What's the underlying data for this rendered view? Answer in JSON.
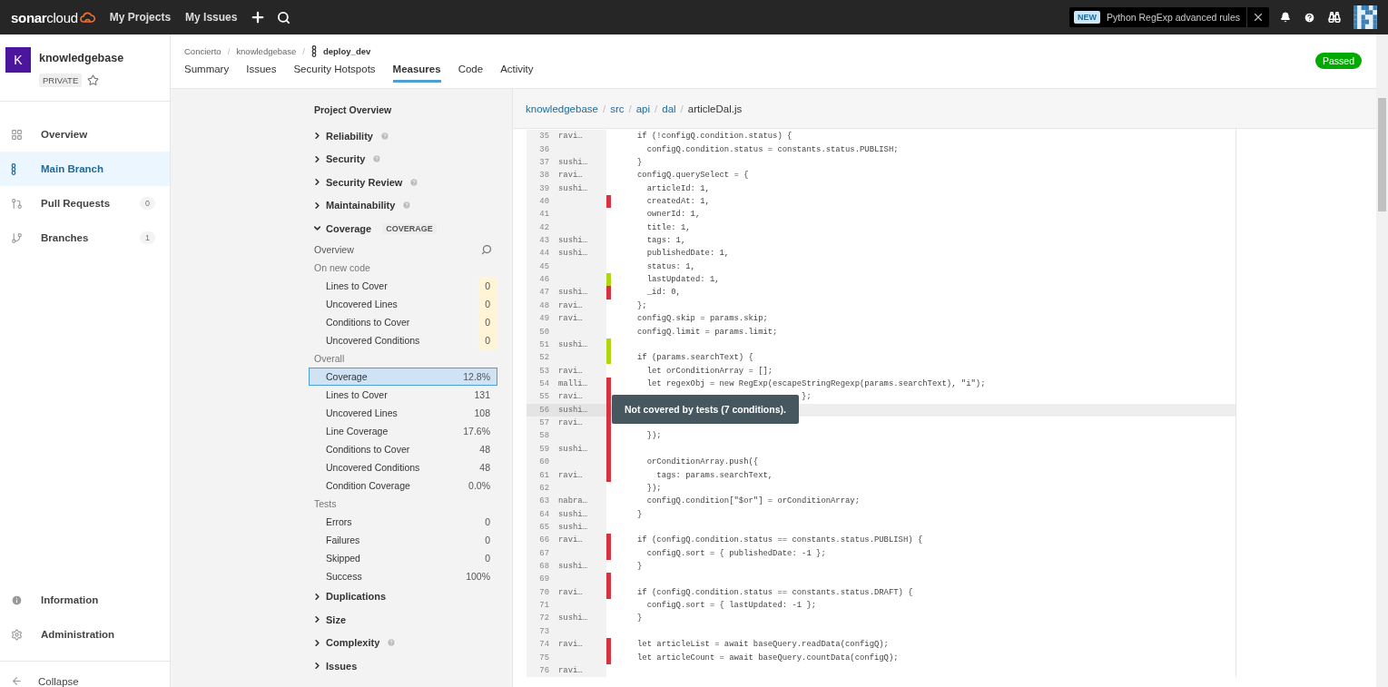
{
  "topbar": {
    "logo": "**sonar**cloud",
    "links": [
      "My Projects",
      "My Issues"
    ],
    "notice": {
      "badge": "NEW",
      "text": "Python RegExp advanced rules"
    }
  },
  "sidebar": {
    "project": {
      "letter": "K",
      "name": "knowledgebase",
      "visibility": "PRIVATE"
    },
    "items": [
      {
        "kind": "overview",
        "label": "Overview",
        "selected": false
      },
      {
        "kind": "branch",
        "label": "Main Branch",
        "selected": true
      },
      {
        "kind": "pull",
        "label": "Pull Requests",
        "count": "0",
        "selected": false
      },
      {
        "kind": "branches",
        "label": "Branches",
        "count": "1",
        "selected": false
      }
    ],
    "bottom_items": [
      {
        "kind": "info",
        "label": "Information"
      },
      {
        "kind": "settings",
        "label": "Administration"
      }
    ],
    "collapse": "Collapse"
  },
  "header": {
    "separator": "/",
    "breadcrumb": [
      "Concierto",
      "knowledgebase"
    ],
    "branch": "deploy_dev",
    "status": "Passed",
    "tabs": [
      {
        "label": "Summary",
        "selected": false
      },
      {
        "label": "Issues",
        "selected": false
      },
      {
        "label": "Security Hotspots",
        "selected": false
      },
      {
        "label": "Measures",
        "selected": true
      },
      {
        "label": "Code",
        "selected": false
      },
      {
        "label": "Activity",
        "selected": false
      }
    ]
  },
  "measures": {
    "title": "Project Overview",
    "domains": [
      {
        "name": "Reliability",
        "help": true,
        "expanded": false
      },
      {
        "name": "Security",
        "help": true,
        "expanded": false
      },
      {
        "name": "Security Review",
        "help": true,
        "expanded": false
      },
      {
        "name": "Maintainability",
        "help": true,
        "expanded": false
      },
      {
        "name": "Coverage",
        "tag": "COVERAGE",
        "help": false,
        "expanded": true,
        "overview": "Overview",
        "groups": [
          {
            "label": "On new code",
            "items": [
              {
                "label": "Lines to Cover",
                "value": "0",
                "new_code": true,
                "selected": false
              },
              {
                "label": "Uncovered Lines",
                "value": "0",
                "new_code": true,
                "selected": false
              },
              {
                "label": "Conditions to Cover",
                "value": "0",
                "new_code": true,
                "selected": false
              },
              {
                "label": "Uncovered Conditions",
                "value": "0",
                "new_code": true,
                "selected": false
              }
            ]
          },
          {
            "label": "Overall",
            "items": [
              {
                "label": "Coverage",
                "value": "12.8%",
                "new_code": false,
                "selected": true
              },
              {
                "label": "Lines to Cover",
                "value": "131",
                "new_code": false,
                "selected": false
              },
              {
                "label": "Uncovered Lines",
                "value": "108",
                "new_code": false,
                "selected": false
              },
              {
                "label": "Line Coverage",
                "value": "17.6%",
                "new_code": false,
                "selected": false
              },
              {
                "label": "Conditions to Cover",
                "value": "48",
                "new_code": false,
                "selected": false
              },
              {
                "label": "Uncovered Conditions",
                "value": "48",
                "new_code": false,
                "selected": false
              },
              {
                "label": "Condition Coverage",
                "value": "0.0%",
                "new_code": false,
                "selected": false
              }
            ]
          },
          {
            "label": "Tests",
            "items": [
              {
                "label": "Errors",
                "value": "0",
                "new_code": false,
                "selected": false
              },
              {
                "label": "Failures",
                "value": "0",
                "new_code": false,
                "selected": false
              },
              {
                "label": "Skipped",
                "value": "0",
                "new_code": false,
                "selected": false
              },
              {
                "label": "Success",
                "value": "100%",
                "new_code": false,
                "selected": false
              }
            ]
          }
        ]
      },
      {
        "name": "Duplications",
        "help": false,
        "expanded": false
      },
      {
        "name": "Size",
        "help": false,
        "expanded": false
      },
      {
        "name": "Complexity",
        "help": true,
        "expanded": false
      },
      {
        "name": "Issues",
        "help": false,
        "expanded": false
      }
    ]
  },
  "source": {
    "separator": "/",
    "path": [
      "knowledgebase",
      "src",
      "api",
      "dal"
    ],
    "file": "articleDal.js",
    "lines": [
      {
        "n": "35",
        "author": "ravi…",
        "code": "if (!configQ.condition.status) {",
        "highlighted": false
      },
      {
        "n": "36",
        "code": "  configQ.condition.status = constants.status.PUBLISH;",
        "highlighted": false
      },
      {
        "n": "37",
        "author": "sushi…",
        "code": "}",
        "highlighted": false
      },
      {
        "n": "38",
        "author": "ravi…",
        "code": "configQ.querySelect = {",
        "highlighted": false
      },
      {
        "n": "39",
        "author": "sushi…",
        "code": "  articleId: 1,",
        "highlighted": false
      },
      {
        "n": "40",
        "covered": false,
        "code": "  createdAt: 1,",
        "highlighted": false
      },
      {
        "n": "41",
        "code": "  ownerId: 1,",
        "highlighted": false
      },
      {
        "n": "42",
        "code": "  title: 1,",
        "highlighted": false
      },
      {
        "n": "43",
        "author": "sushi…",
        "code": "  tags: 1,",
        "highlighted": false
      },
      {
        "n": "44",
        "author": "sushi…",
        "code": "  publishedDate: 1,",
        "highlighted": false
      },
      {
        "n": "45",
        "code": "  status: 1,",
        "highlighted": false
      },
      {
        "n": "46",
        "covered": true,
        "code": "  lastUpdated: 1,",
        "highlighted": false
      },
      {
        "n": "47",
        "author": "sushi…",
        "covered": false,
        "code": "  _id: 0,",
        "highlighted": false
      },
      {
        "n": "48",
        "author": "ravi…",
        "code": "};",
        "highlighted": false
      },
      {
        "n": "49",
        "author": "ravi…",
        "code": "configQ.skip = params.skip;",
        "highlighted": false
      },
      {
        "n": "50",
        "code": "configQ.limit = params.limit;",
        "highlighted": false
      },
      {
        "n": "51",
        "author": "sushi…",
        "covered": true,
        "highlighted": false
      },
      {
        "n": "52",
        "covered": true,
        "code": "if (params.searchText) {",
        "highlighted": false
      },
      {
        "n": "53",
        "author": "ravi…",
        "code": "  let orConditionArray = [];",
        "highlighted": false
      },
      {
        "n": "54",
        "author": "malli…",
        "covered": false,
        "code": "  let regexObj = new RegExp(escapeStringRegexp(params.searchText), \"i\");",
        "highlighted": false
      },
      {
        "n": "55",
        "author": "ravi…",
        "covered": false,
        "code": "                                  };",
        "highlighted": false
      },
      {
        "n": "56",
        "author": "sushi…",
        "covered": false,
        "highlighted": true,
        "tooltip": "Not covered by tests (7 conditions)."
      },
      {
        "n": "57",
        "author": "ravi…",
        "covered": false,
        "highlighted": false
      },
      {
        "n": "58",
        "covered": false,
        "code": "  });",
        "highlighted": false
      },
      {
        "n": "59",
        "author": "sushi…",
        "covered": false,
        "highlighted": false
      },
      {
        "n": "60",
        "covered": false,
        "code": "  orConditionArray.push({",
        "highlighted": false
      },
      {
        "n": "61",
        "author": "ravi…",
        "covered": false,
        "code": "    tags: params.searchText,",
        "highlighted": false
      },
      {
        "n": "62",
        "code": "  });",
        "highlighted": false
      },
      {
        "n": "63",
        "author": "nabra…",
        "code": "  configQ.condition[\"$or\"] = orConditionArray;",
        "highlighted": false
      },
      {
        "n": "64",
        "author": "sushi…",
        "code": "}",
        "highlighted": false
      },
      {
        "n": "65",
        "author": "sushi…",
        "highlighted": false
      },
      {
        "n": "66",
        "author": "ravi…",
        "covered": false,
        "code": "if (configQ.condition.status == constants.status.PUBLISH) {",
        "highlighted": false
      },
      {
        "n": "67",
        "covered": false,
        "code": "  configQ.sort = { publishedDate: -1 };",
        "highlighted": false
      },
      {
        "n": "68",
        "author": "sushi…",
        "code": "}",
        "highlighted": false
      },
      {
        "n": "69",
        "covered": false,
        "highlighted": false
      },
      {
        "n": "70",
        "author": "ravi…",
        "covered": false,
        "code": "if (configQ.condition.status == constants.status.DRAFT) {",
        "highlighted": false
      },
      {
        "n": "71",
        "code": "  configQ.sort = { lastUpdated: -1 };",
        "highlighted": false
      },
      {
        "n": "72",
        "author": "sushi…",
        "code": "}",
        "highlighted": false
      },
      {
        "n": "73",
        "highlighted": false
      },
      {
        "n": "74",
        "author": "ravi…",
        "covered": false,
        "code": "let articleList = await baseQuery.readData(configQ);",
        "highlighted": false
      },
      {
        "n": "75",
        "covered": false,
        "code": "let articleCount = await baseQuery.countData(configQ);",
        "highlighted": false
      },
      {
        "n": "76",
        "author": "ravi…",
        "highlighted": false
      }
    ]
  }
}
